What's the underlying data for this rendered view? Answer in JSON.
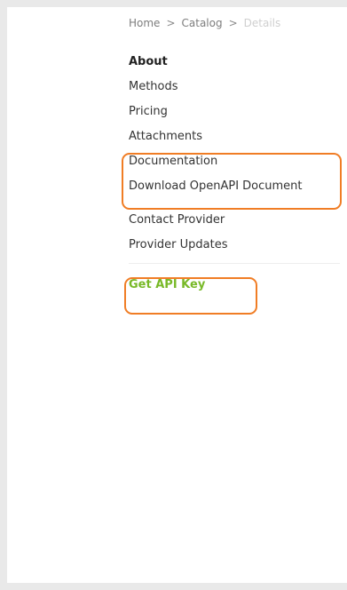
{
  "breadcrumb": {
    "items": [
      "Home",
      "Catalog",
      "Details"
    ],
    "separator": ">"
  },
  "nav": {
    "primary": [
      "About",
      "Methods",
      "Pricing",
      "Attachments"
    ],
    "documents": [
      "Documentation",
      "Download OpenAPI Document"
    ],
    "contact": [
      "Contact Provider",
      "Provider Updates"
    ],
    "cta": "Get API Key"
  },
  "colors": {
    "accent_green": "#78b928",
    "highlight_orange": "#f07d25",
    "text_dark": "#333333",
    "breadcrumb_text": "#7d7d7d",
    "breadcrumb_current": "#cfcfcf"
  }
}
